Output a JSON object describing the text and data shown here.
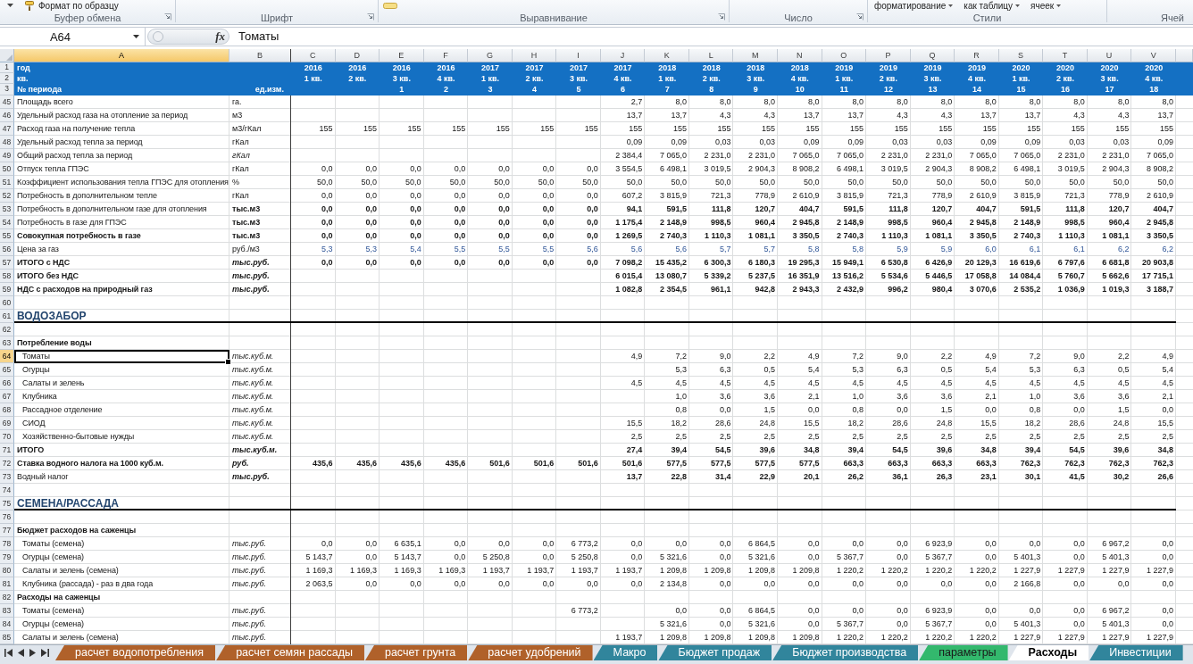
{
  "ribbon": {
    "groups": [
      {
        "label": "Буфер обмена",
        "launcher": true,
        "items": [
          {
            "label": "Формат по образцу",
            "dropdown": false
          }
        ]
      },
      {
        "label": "Шрифт",
        "launcher": true
      },
      {
        "label": "Выравнивание",
        "launcher": true
      },
      {
        "label": "Число",
        "launcher": true
      },
      {
        "label": "Стили",
        "launcher": false,
        "items": [
          {
            "label": "форматирование",
            "dropdown": true
          },
          {
            "label": "как таблицу",
            "dropdown": true
          },
          {
            "label": "ячеек",
            "dropdown": true
          }
        ]
      },
      {
        "label": "Ячей",
        "launcher": false
      }
    ]
  },
  "formula_bar": {
    "name_box": "A64",
    "function_button": "fx",
    "formula": "Томаты"
  },
  "columns": [
    {
      "letter": "A",
      "selected": true
    },
    {
      "letter": "B",
      "selected": false
    },
    {
      "letter": "C",
      "selected": false
    },
    {
      "letter": "D",
      "selected": false
    },
    {
      "letter": "E",
      "selected": false
    },
    {
      "letter": "F",
      "selected": false
    },
    {
      "letter": "G",
      "selected": false
    },
    {
      "letter": "H",
      "selected": false
    },
    {
      "letter": "I",
      "selected": false
    },
    {
      "letter": "J",
      "selected": false
    },
    {
      "letter": "K",
      "selected": false
    },
    {
      "letter": "L",
      "selected": false
    },
    {
      "letter": "M",
      "selected": false
    },
    {
      "letter": "N",
      "selected": false
    },
    {
      "letter": "O",
      "selected": false
    },
    {
      "letter": "P",
      "selected": false
    },
    {
      "letter": "Q",
      "selected": false
    },
    {
      "letter": "R",
      "selected": false
    },
    {
      "letter": "S",
      "selected": false
    },
    {
      "letter": "T",
      "selected": false
    },
    {
      "letter": "U",
      "selected": false
    },
    {
      "letter": "V",
      "selected": false
    }
  ],
  "header_rows": [
    {
      "row": "1",
      "selected": false,
      "label": "год",
      "values": {
        "C": "2016",
        "D": "2016",
        "E": "2016",
        "F": "2016",
        "G": "2017",
        "H": "2017",
        "I": "2017",
        "J": "2017",
        "K": "2018",
        "L": "2018",
        "M": "2018",
        "N": "2018",
        "O": "2019",
        "P": "2019",
        "Q": "2019",
        "R": "2019",
        "S": "2020",
        "T": "2020",
        "U": "2020",
        "V": "2020"
      }
    },
    {
      "row": "2",
      "selected": false,
      "label": "кв.",
      "values": {
        "C": "1 кв.",
        "D": "2 кв.",
        "E": "3 кв.",
        "F": "4 кв.",
        "G": "1 кв.",
        "H": "2 кв.",
        "I": "3 кв.",
        "J": "4 кв.",
        "K": "1 кв.",
        "L": "2 кв.",
        "M": "3 кв.",
        "N": "4 кв.",
        "O": "1 кв.",
        "P": "2 кв.",
        "Q": "3 кв.",
        "R": "4 кв.",
        "S": "1 кв.",
        "T": "2 кв.",
        "U": "3 кв.",
        "V": "4 кв."
      }
    },
    {
      "row": "3",
      "selected": false,
      "label": "№ периода",
      "unit": "ед.изм.",
      "values": {
        "E": "1",
        "F": "2",
        "G": "3",
        "H": "4",
        "I": "5",
        "J": "6",
        "K": "7",
        "L": "8",
        "M": "9",
        "N": "10",
        "O": "11",
        "P": "12",
        "Q": "13",
        "R": "14",
        "S": "15",
        "T": "16",
        "U": "17",
        "V": "18"
      }
    }
  ],
  "rows": [
    {
      "row": "45",
      "selected": false,
      "kind": "data",
      "label": "Площадь всего",
      "unit": "га.",
      "label_bold": false,
      "values_bold": false,
      "unit_italic": false,
      "indented": false,
      "input": false,
      "values": {
        "J": "2,7",
        "K": "8,0",
        "L": "8,0",
        "M": "8,0",
        "N": "8,0",
        "O": "8,0",
        "P": "8,0",
        "Q": "8,0",
        "R": "8,0",
        "S": "8,0",
        "T": "8,0",
        "U": "8,0",
        "V": "8,0"
      }
    },
    {
      "row": "46",
      "selected": false,
      "kind": "data",
      "label": "Удельный расход газа на отопление за период",
      "unit": "м3",
      "label_bold": false,
      "values_bold": false,
      "unit_italic": false,
      "indented": false,
      "input": false,
      "values": {
        "J": "13,7",
        "K": "13,7",
        "L": "4,3",
        "M": "4,3",
        "N": "13,7",
        "O": "13,7",
        "P": "4,3",
        "Q": "4,3",
        "R": "13,7",
        "S": "13,7",
        "T": "4,3",
        "U": "4,3",
        "V": "13,7"
      }
    },
    {
      "row": "47",
      "selected": false,
      "kind": "data",
      "label": "Расход газа на получение тепла",
      "unit": "м3/гКал",
      "label_bold": false,
      "values_bold": false,
      "unit_italic": false,
      "indented": false,
      "input": false,
      "values": {
        "C": "155",
        "D": "155",
        "E": "155",
        "F": "155",
        "G": "155",
        "H": "155",
        "I": "155",
        "J": "155",
        "K": "155",
        "L": "155",
        "M": "155",
        "N": "155",
        "O": "155",
        "P": "155",
        "Q": "155",
        "R": "155",
        "S": "155",
        "T": "155",
        "U": "155",
        "V": "155"
      }
    },
    {
      "row": "48",
      "selected": false,
      "kind": "data",
      "label": "Удельный расход тепла за период",
      "unit": "гКал",
      "label_bold": false,
      "values_bold": false,
      "unit_italic": false,
      "indented": false,
      "input": false,
      "values": {
        "J": "0,09",
        "K": "0,09",
        "L": "0,03",
        "M": "0,03",
        "N": "0,09",
        "O": "0,09",
        "P": "0,03",
        "Q": "0,03",
        "R": "0,09",
        "S": "0,09",
        "T": "0,03",
        "U": "0,03",
        "V": "0,09"
      }
    },
    {
      "row": "49",
      "selected": false,
      "kind": "data",
      "label": "Общий расход тепла за период",
      "unit": "гКал",
      "label_bold": false,
      "values_bold": false,
      "unit_italic": true,
      "indented": false,
      "input": false,
      "values": {
        "J": "2 384,4",
        "K": "7 065,0",
        "L": "2 231,0",
        "M": "2 231,0",
        "N": "7 065,0",
        "O": "7 065,0",
        "P": "2 231,0",
        "Q": "2 231,0",
        "R": "7 065,0",
        "S": "7 065,0",
        "T": "2 231,0",
        "U": "2 231,0",
        "V": "7 065,0"
      }
    },
    {
      "row": "50",
      "selected": false,
      "kind": "data",
      "label": "Отпуск тепла ГПЭС",
      "unit": "гКал",
      "label_bold": false,
      "values_bold": false,
      "unit_italic": false,
      "indented": false,
      "input": false,
      "values": {
        "C": "0,0",
        "D": "0,0",
        "E": "0,0",
        "F": "0,0",
        "G": "0,0",
        "H": "0,0",
        "I": "0,0",
        "J": "3 554,5",
        "K": "6 498,1",
        "L": "3 019,5",
        "M": "2 904,3",
        "N": "8 908,2",
        "O": "6 498,1",
        "P": "3 019,5",
        "Q": "2 904,3",
        "R": "8 908,2",
        "S": "6 498,1",
        "T": "3 019,5",
        "U": "2 904,3",
        "V": "8 908,2"
      }
    },
    {
      "row": "51",
      "selected": false,
      "kind": "data",
      "label": "Коэффициент использования тепла ГПЭС для отопления",
      "unit": "%",
      "label_bold": false,
      "values_bold": false,
      "unit_italic": false,
      "indented": false,
      "input": false,
      "values": {
        "C": "50,0",
        "D": "50,0",
        "E": "50,0",
        "F": "50,0",
        "G": "50,0",
        "H": "50,0",
        "I": "50,0",
        "J": "50,0",
        "K": "50,0",
        "L": "50,0",
        "M": "50,0",
        "N": "50,0",
        "O": "50,0",
        "P": "50,0",
        "Q": "50,0",
        "R": "50,0",
        "S": "50,0",
        "T": "50,0",
        "U": "50,0",
        "V": "50,0"
      }
    },
    {
      "row": "52",
      "selected": false,
      "kind": "data",
      "label": "Потребность в дополнительном тепле",
      "unit": "гКал",
      "label_bold": false,
      "values_bold": false,
      "unit_italic": false,
      "indented": false,
      "input": false,
      "values": {
        "C": "0,0",
        "D": "0,0",
        "E": "0,0",
        "F": "0,0",
        "G": "0,0",
        "H": "0,0",
        "I": "0,0",
        "J": "607,2",
        "K": "3 815,9",
        "L": "721,3",
        "M": "778,9",
        "N": "2 610,9",
        "O": "3 815,9",
        "P": "721,3",
        "Q": "778,9",
        "R": "2 610,9",
        "S": "3 815,9",
        "T": "721,3",
        "U": "778,9",
        "V": "2 610,9"
      }
    },
    {
      "row": "53",
      "selected": false,
      "kind": "data",
      "label": "Потребность в дополнительном газе для отопления",
      "unit": "тыс.м3",
      "label_bold": false,
      "values_bold": true,
      "unit_italic": false,
      "indented": false,
      "input": false,
      "values": {
        "C": "0,0",
        "D": "0,0",
        "E": "0,0",
        "F": "0,0",
        "G": "0,0",
        "H": "0,0",
        "I": "0,0",
        "J": "94,1",
        "K": "591,5",
        "L": "111,8",
        "M": "120,7",
        "N": "404,7",
        "O": "591,5",
        "P": "111,8",
        "Q": "120,7",
        "R": "404,7",
        "S": "591,5",
        "T": "111,8",
        "U": "120,7",
        "V": "404,7"
      }
    },
    {
      "row": "54",
      "selected": false,
      "kind": "data",
      "label": "Потребность в газе для ГПЭС",
      "unit": "тыс.м3",
      "label_bold": false,
      "values_bold": true,
      "unit_italic": false,
      "indented": false,
      "input": false,
      "values": {
        "C": "0,0",
        "D": "0,0",
        "E": "0,0",
        "F": "0,0",
        "G": "0,0",
        "H": "0,0",
        "I": "0,0",
        "J": "1 175,4",
        "K": "2 148,9",
        "L": "998,5",
        "M": "960,4",
        "N": "2 945,8",
        "O": "2 148,9",
        "P": "998,5",
        "Q": "960,4",
        "R": "2 945,8",
        "S": "2 148,9",
        "T": "998,5",
        "U": "960,4",
        "V": "2 945,8"
      }
    },
    {
      "row": "55",
      "selected": false,
      "kind": "data",
      "label": "Совокупная потребность в газе",
      "unit": "тыс.м3",
      "label_bold": true,
      "values_bold": true,
      "unit_italic": false,
      "indented": false,
      "input": false,
      "values": {
        "C": "0,0",
        "D": "0,0",
        "E": "0,0",
        "F": "0,0",
        "G": "0,0",
        "H": "0,0",
        "I": "0,0",
        "J": "1 269,5",
        "K": "2 740,3",
        "L": "1 110,3",
        "M": "1 081,1",
        "N": "3 350,5",
        "O": "2 740,3",
        "P": "1 110,3",
        "Q": "1 081,1",
        "R": "3 350,5",
        "S": "2 740,3",
        "T": "1 110,3",
        "U": "1 081,1",
        "V": "3 350,5"
      }
    },
    {
      "row": "56",
      "selected": false,
      "kind": "data",
      "label": "Цена за газ",
      "unit": "руб./м3",
      "label_bold": false,
      "values_bold": false,
      "unit_italic": false,
      "indented": false,
      "input": true,
      "values": {
        "C": "5,3",
        "D": "5,3",
        "E": "5,4",
        "F": "5,5",
        "G": "5,5",
        "H": "5,5",
        "I": "5,6",
        "J": "5,6",
        "K": "5,6",
        "L": "5,7",
        "M": "5,7",
        "N": "5,8",
        "O": "5,8",
        "P": "5,9",
        "Q": "5,9",
        "R": "6,0",
        "S": "6,1",
        "T": "6,1",
        "U": "6,2",
        "V": "6,2"
      }
    },
    {
      "row": "57",
      "selected": false,
      "kind": "data",
      "label": "ИТОГО с НДС",
      "unit": "тыс.руб.",
      "label_bold": true,
      "values_bold": true,
      "unit_italic": true,
      "indented": false,
      "input": false,
      "values": {
        "C": "0,0",
        "D": "0,0",
        "E": "0,0",
        "F": "0,0",
        "G": "0,0",
        "H": "0,0",
        "I": "0,0",
        "J": "7 098,2",
        "K": "15 435,2",
        "L": "6 300,3",
        "M": "6 180,3",
        "N": "19 295,3",
        "O": "15 949,1",
        "P": "6 530,8",
        "Q": "6 426,9",
        "R": "20 129,3",
        "S": "16 619,6",
        "T": "6 797,6",
        "U": "6 681,8",
        "V": "20 903,8"
      }
    },
    {
      "row": "58",
      "selected": false,
      "kind": "data",
      "label": "ИТОГО без НДС",
      "unit": "тыс.руб.",
      "label_bold": true,
      "values_bold": true,
      "unit_italic": true,
      "indented": false,
      "input": false,
      "values": {
        "J": "6 015,4",
        "K": "13 080,7",
        "L": "5 339,2",
        "M": "5 237,5",
        "N": "16 351,9",
        "O": "13 516,2",
        "P": "5 534,6",
        "Q": "5 446,5",
        "R": "17 058,8",
        "S": "14 084,4",
        "T": "5 760,7",
        "U": "5 662,6",
        "V": "17 715,1"
      }
    },
    {
      "row": "59",
      "selected": false,
      "kind": "data",
      "label": "НДС с расходов на природный газ",
      "unit": "тыс.руб.",
      "label_bold": true,
      "values_bold": true,
      "unit_italic": true,
      "indented": false,
      "input": false,
      "values": {
        "J": "1 082,8",
        "K": "2 354,5",
        "L": "961,1",
        "M": "942,8",
        "N": "2 943,3",
        "O": "2 432,9",
        "P": "996,2",
        "Q": "980,4",
        "R": "3 070,6",
        "S": "2 535,2",
        "T": "1 036,9",
        "U": "1 019,3",
        "V": "3 188,7"
      }
    },
    {
      "row": "60",
      "selected": false,
      "kind": "blank"
    },
    {
      "row": "61",
      "selected": false,
      "kind": "section",
      "label": "ВОДОЗАБОР"
    },
    {
      "row": "62",
      "selected": false,
      "kind": "blank"
    },
    {
      "row": "63",
      "selected": false,
      "kind": "subheading",
      "label": "Потребление воды"
    },
    {
      "row": "64",
      "selected": true,
      "kind": "data",
      "label": "Томаты",
      "unit": "тыс.куб.м.",
      "label_bold": false,
      "values_bold": false,
      "unit_italic": true,
      "indented": true,
      "input": false,
      "values": {
        "J": "4,9",
        "K": "7,2",
        "L": "9,0",
        "M": "2,2",
        "N": "4,9",
        "O": "7,2",
        "P": "9,0",
        "Q": "2,2",
        "R": "4,9",
        "S": "7,2",
        "T": "9,0",
        "U": "2,2",
        "V": "4,9"
      }
    },
    {
      "row": "65",
      "selected": false,
      "kind": "data",
      "label": "Огурцы",
      "unit": "тыс.куб.м.",
      "label_bold": false,
      "values_bold": false,
      "unit_italic": true,
      "indented": true,
      "input": false,
      "values": {
        "K": "5,3",
        "L": "6,3",
        "M": "0,5",
        "N": "5,4",
        "O": "5,3",
        "P": "6,3",
        "Q": "0,5",
        "R": "5,4",
        "S": "5,3",
        "T": "6,3",
        "U": "0,5",
        "V": "5,4"
      }
    },
    {
      "row": "66",
      "selected": false,
      "kind": "data",
      "label": "Салаты и зелень",
      "unit": "тыс.куб.м.",
      "label_bold": false,
      "values_bold": false,
      "unit_italic": true,
      "indented": true,
      "input": false,
      "values": {
        "J": "4,5",
        "K": "4,5",
        "L": "4,5",
        "M": "4,5",
        "N": "4,5",
        "O": "4,5",
        "P": "4,5",
        "Q": "4,5",
        "R": "4,5",
        "S": "4,5",
        "T": "4,5",
        "U": "4,5",
        "V": "4,5"
      }
    },
    {
      "row": "67",
      "selected": false,
      "kind": "data",
      "label": "Клубника",
      "unit": "тыс.куб.м.",
      "label_bold": false,
      "values_bold": false,
      "unit_italic": true,
      "indented": true,
      "input": false,
      "values": {
        "K": "1,0",
        "L": "3,6",
        "M": "3,6",
        "N": "2,1",
        "O": "1,0",
        "P": "3,6",
        "Q": "3,6",
        "R": "2,1",
        "S": "1,0",
        "T": "3,6",
        "U": "3,6",
        "V": "2,1"
      }
    },
    {
      "row": "68",
      "selected": false,
      "kind": "data",
      "label": "Рассадное отделение",
      "unit": "тыс.куб.м.",
      "label_bold": false,
      "values_bold": false,
      "unit_italic": true,
      "indented": true,
      "input": false,
      "values": {
        "K": "0,8",
        "L": "0,0",
        "M": "1,5",
        "N": "0,0",
        "O": "0,8",
        "P": "0,0",
        "Q": "1,5",
        "R": "0,0",
        "S": "0,8",
        "T": "0,0",
        "U": "1,5",
        "V": "0,0"
      }
    },
    {
      "row": "69",
      "selected": false,
      "kind": "data",
      "label": "СИОД",
      "unit": "тыс.куб.м.",
      "label_bold": false,
      "values_bold": false,
      "unit_italic": true,
      "indented": true,
      "input": false,
      "values": {
        "J": "15,5",
        "K": "18,2",
        "L": "28,6",
        "M": "24,8",
        "N": "15,5",
        "O": "18,2",
        "P": "28,6",
        "Q": "24,8",
        "R": "15,5",
        "S": "18,2",
        "T": "28,6",
        "U": "24,8",
        "V": "15,5"
      }
    },
    {
      "row": "70",
      "selected": false,
      "kind": "data",
      "label": "Хозяйственно-бытовые нужды",
      "unit": "тыс.куб.м.",
      "label_bold": false,
      "values_bold": false,
      "unit_italic": true,
      "indented": true,
      "input": false,
      "values": {
        "J": "2,5",
        "K": "2,5",
        "L": "2,5",
        "M": "2,5",
        "N": "2,5",
        "O": "2,5",
        "P": "2,5",
        "Q": "2,5",
        "R": "2,5",
        "S": "2,5",
        "T": "2,5",
        "U": "2,5",
        "V": "2,5"
      }
    },
    {
      "row": "71",
      "selected": false,
      "kind": "data",
      "label": "ИТОГО",
      "unit": "тыс.куб.м.",
      "label_bold": true,
      "values_bold": true,
      "unit_italic": true,
      "indented": false,
      "input": false,
      "values": {
        "J": "27,4",
        "K": "39,4",
        "L": "54,5",
        "M": "39,6",
        "N": "34,8",
        "O": "39,4",
        "P": "54,5",
        "Q": "39,6",
        "R": "34,8",
        "S": "39,4",
        "T": "54,5",
        "U": "39,6",
        "V": "34,8"
      }
    },
    {
      "row": "72",
      "selected": false,
      "kind": "data",
      "label": "Ставка водного налога на 1000 куб.м.",
      "unit": "руб.",
      "label_bold": true,
      "values_bold": true,
      "unit_italic": true,
      "indented": false,
      "input": false,
      "values": {
        "C": "435,6",
        "D": "435,6",
        "E": "435,6",
        "F": "435,6",
        "G": "501,6",
        "H": "501,6",
        "I": "501,6",
        "J": "501,6",
        "K": "577,5",
        "L": "577,5",
        "M": "577,5",
        "N": "577,5",
        "O": "663,3",
        "P": "663,3",
        "Q": "663,3",
        "R": "663,3",
        "S": "762,3",
        "T": "762,3",
        "U": "762,3",
        "V": "762,3"
      }
    },
    {
      "row": "73",
      "selected": false,
      "kind": "data",
      "label": "Водный налог",
      "unit": "тыс.руб.",
      "label_bold": false,
      "values_bold": true,
      "unit_italic": true,
      "indented": false,
      "input": false,
      "values": {
        "J": "13,7",
        "K": "22,8",
        "L": "31,4",
        "M": "22,9",
        "N": "20,1",
        "O": "26,2",
        "P": "36,1",
        "Q": "26,3",
        "R": "23,1",
        "S": "30,1",
        "T": "41,5",
        "U": "30,2",
        "V": "26,6"
      }
    },
    {
      "row": "74",
      "selected": false,
      "kind": "blank"
    },
    {
      "row": "75",
      "selected": false,
      "kind": "section",
      "label": "СЕМЕНА/РАССАДА"
    },
    {
      "row": "76",
      "selected": false,
      "kind": "blank"
    },
    {
      "row": "77",
      "selected": false,
      "kind": "subheading",
      "label": "Бюджет расходов на саженцы"
    },
    {
      "row": "78",
      "selected": false,
      "kind": "data",
      "label": "Томаты (семена)",
      "unit": "тыс.руб.",
      "label_bold": false,
      "values_bold": false,
      "unit_italic": true,
      "indented": true,
      "input": false,
      "values": {
        "C": "0,0",
        "D": "0,0",
        "E": "6 635,1",
        "F": "0,0",
        "G": "0,0",
        "H": "0,0",
        "I": "6 773,2",
        "J": "0,0",
        "K": "0,0",
        "L": "0,0",
        "M": "6 864,5",
        "N": "0,0",
        "O": "0,0",
        "P": "0,0",
        "Q": "6 923,9",
        "R": "0,0",
        "S": "0,0",
        "T": "0,0",
        "U": "6 967,2",
        "V": "0,0"
      }
    },
    {
      "row": "79",
      "selected": false,
      "kind": "data",
      "label": "Огурцы (семена)",
      "unit": "тыс.руб.",
      "label_bold": false,
      "values_bold": false,
      "unit_italic": true,
      "indented": true,
      "input": false,
      "values": {
        "C": "5 143,7",
        "D": "0,0",
        "E": "5 143,7",
        "F": "0,0",
        "G": "5 250,8",
        "H": "0,0",
        "I": "5 250,8",
        "J": "0,0",
        "K": "5 321,6",
        "L": "0,0",
        "M": "5 321,6",
        "N": "0,0",
        "O": "5 367,7",
        "P": "0,0",
        "Q": "5 367,7",
        "R": "0,0",
        "S": "5 401,3",
        "T": "0,0",
        "U": "5 401,3",
        "V": "0,0"
      }
    },
    {
      "row": "80",
      "selected": false,
      "kind": "data",
      "label": "Салаты и зелень (семена)",
      "unit": "тыс.руб.",
      "label_bold": false,
      "values_bold": false,
      "unit_italic": true,
      "indented": true,
      "input": false,
      "values": {
        "C": "1 169,3",
        "D": "1 169,3",
        "E": "1 169,3",
        "F": "1 169,3",
        "G": "1 193,7",
        "H": "1 193,7",
        "I": "1 193,7",
        "J": "1 193,7",
        "K": "1 209,8",
        "L": "1 209,8",
        "M": "1 209,8",
        "N": "1 209,8",
        "O": "1 220,2",
        "P": "1 220,2",
        "Q": "1 220,2",
        "R": "1 220,2",
        "S": "1 227,9",
        "T": "1 227,9",
        "U": "1 227,9",
        "V": "1 227,9"
      }
    },
    {
      "row": "81",
      "selected": false,
      "kind": "data",
      "label": "Клубника (рассада) - раз в два года",
      "unit": "тыс.руб.",
      "label_bold": false,
      "values_bold": false,
      "unit_italic": true,
      "indented": true,
      "input": false,
      "values": {
        "C": "2 063,5",
        "D": "0,0",
        "E": "0,0",
        "F": "0,0",
        "G": "0,0",
        "H": "0,0",
        "I": "0,0",
        "J": "0,0",
        "K": "2 134,8",
        "L": "0,0",
        "M": "0,0",
        "N": "0,0",
        "O": "0,0",
        "P": "0,0",
        "Q": "0,0",
        "R": "0,0",
        "S": "2 166,8",
        "T": "0,0",
        "U": "0,0",
        "V": "0,0"
      }
    },
    {
      "row": "82",
      "selected": false,
      "kind": "subheading",
      "label": "Расходы на саженцы"
    },
    {
      "row": "83",
      "selected": false,
      "kind": "data",
      "label": "Томаты (семена)",
      "unit": "тыс.руб.",
      "label_bold": false,
      "values_bold": false,
      "unit_italic": true,
      "indented": true,
      "input": false,
      "values": {
        "I": "6 773,2",
        "K": "0,0",
        "L": "0,0",
        "M": "6 864,5",
        "N": "0,0",
        "O": "0,0",
        "P": "0,0",
        "Q": "6 923,9",
        "R": "0,0",
        "S": "0,0",
        "T": "0,0",
        "U": "6 967,2",
        "V": "0,0"
      }
    },
    {
      "row": "84",
      "selected": false,
      "kind": "data",
      "label": "Огурцы (семена)",
      "unit": "тыс.руб.",
      "label_bold": false,
      "values_bold": false,
      "unit_italic": true,
      "indented": true,
      "input": false,
      "values": {
        "K": "5 321,6",
        "L": "0,0",
        "M": "5 321,6",
        "N": "0,0",
        "O": "5 367,7",
        "P": "0,0",
        "Q": "5 367,7",
        "R": "0,0",
        "S": "5 401,3",
        "T": "0,0",
        "U": "5 401,3",
        "V": "0,0"
      }
    },
    {
      "row": "85",
      "selected": false,
      "kind": "data",
      "label": "Салаты и зелень (семена)",
      "unit": "тыс.руб.",
      "label_bold": false,
      "values_bold": false,
      "unit_italic": true,
      "indented": true,
      "input": false,
      "values": {
        "J": "1 193,7",
        "K": "1 209,8",
        "L": "1 209,8",
        "M": "1 209,8",
        "N": "1 209,8",
        "O": "1 220,2",
        "P": "1 220,2",
        "Q": "1 220,2",
        "R": "1 220,2",
        "S": "1 227,9",
        "T": "1 227,9",
        "U": "1 227,9",
        "V": "1 227,9"
      }
    }
  ],
  "sheet_tabs": [
    {
      "label": "расчет водопотребления",
      "color": "#b0612a",
      "selected": false
    },
    {
      "label": "расчет семян рассады",
      "color": "#b0612a",
      "selected": false
    },
    {
      "label": "расчет грунта",
      "color": "#b0612a",
      "selected": false
    },
    {
      "label": "расчет удобрений",
      "color": "#b0612a",
      "selected": false
    },
    {
      "label": "Макро",
      "color": "#31859c",
      "selected": false
    },
    {
      "label": "Бюджет продаж",
      "color": "#31859c",
      "selected": false
    },
    {
      "label": "Бюджет производства",
      "color": "#31859c",
      "selected": false
    },
    {
      "label": "параметры",
      "color": "#33b86d",
      "selected": false
    },
    {
      "label": "Расходы",
      "selected": true
    },
    {
      "label": "Инвестиции",
      "color": "#31859c",
      "selected": false
    }
  ]
}
